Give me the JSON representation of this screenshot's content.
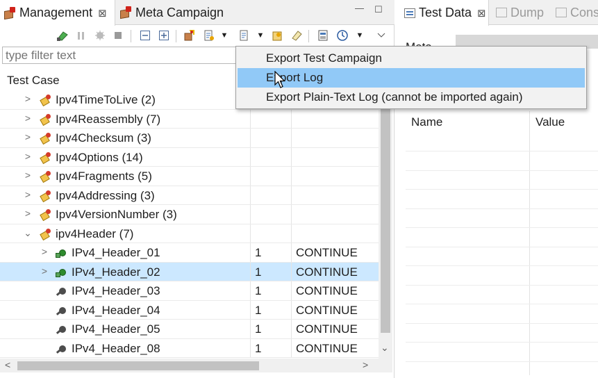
{
  "left_view": {
    "tabs": [
      {
        "label": "Management",
        "close": "⊠"
      },
      {
        "label": "Meta Campaign"
      }
    ],
    "window_buttons": {
      "minimize": "—",
      "maximize": "☐"
    },
    "filter": {
      "placeholder": "type filter text",
      "value": ""
    },
    "tree": {
      "column_header": "Test Case",
      "rows": [
        {
          "label": "Ipv4TimeToLive (2)",
          "twisty": ">",
          "icon": "test-group-icon",
          "iter": "",
          "result": ""
        },
        {
          "label": "Ipv4Reassembly (7)",
          "twisty": ">",
          "icon": "test-group-icon",
          "iter": "",
          "result": ""
        },
        {
          "label": "Ipv4Checksum (3)",
          "twisty": ">",
          "icon": "test-group-icon",
          "iter": "",
          "result": ""
        },
        {
          "label": "Ipv4Options (14)",
          "twisty": ">",
          "icon": "test-group-icon",
          "iter": "",
          "result": ""
        },
        {
          "label": "Ipv4Fragments (5)",
          "twisty": ">",
          "icon": "test-group-icon",
          "iter": "",
          "result": ""
        },
        {
          "label": "Ipv4Addressing (3)",
          "twisty": ">",
          "icon": "test-group-icon",
          "iter": "",
          "result": ""
        },
        {
          "label": "Ipv4VersionNumber (3)",
          "twisty": ">",
          "icon": "test-group-icon",
          "iter": "",
          "result": ""
        },
        {
          "label": "ipv4Header (7)",
          "twisty": "⌄",
          "icon": "test-group-icon",
          "iter": "",
          "result": ""
        },
        {
          "label": "IPv4_Header_01",
          "twisty": ">",
          "icon": "test-case-run-icon",
          "iter": "1",
          "result": "CONTINUE"
        },
        {
          "label": "IPv4_Header_02",
          "twisty": ">",
          "icon": "test-case-run-icon",
          "iter": "1",
          "result": "CONTINUE"
        },
        {
          "label": "IPv4_Header_03",
          "twisty": "",
          "icon": "test-case-icon",
          "iter": "1",
          "result": "CONTINUE"
        },
        {
          "label": "IPv4_Header_04",
          "twisty": "",
          "icon": "test-case-icon",
          "iter": "1",
          "result": "CONTINUE"
        },
        {
          "label": "IPv4_Header_05",
          "twisty": "",
          "icon": "test-case-icon",
          "iter": "1",
          "result": "CONTINUE"
        },
        {
          "label": "IPv4_Header_08",
          "twisty": "",
          "icon": "test-case-icon",
          "iter": "1",
          "result": "CONTINUE"
        }
      ]
    },
    "scroll": {
      "down": "⌄",
      "left": "<",
      "right": ">"
    }
  },
  "right_view": {
    "tabs": [
      {
        "label": "Test Data",
        "close": "⊠"
      },
      {
        "label": "Dump"
      },
      {
        "label": "Cons"
      }
    ],
    "partial_label": "Meta",
    "table_headers": [
      "Name",
      "Value"
    ]
  },
  "context_menu": {
    "items": [
      "Export Test Campaign",
      "Export Log",
      "Export Plain-Text Log (cannot be imported again)"
    ],
    "hovered_index": 1
  },
  "colors": {
    "selection": "#cce8ff",
    "menu_hover": "#91c9f7",
    "tab_bar": "#f0f0f0"
  }
}
